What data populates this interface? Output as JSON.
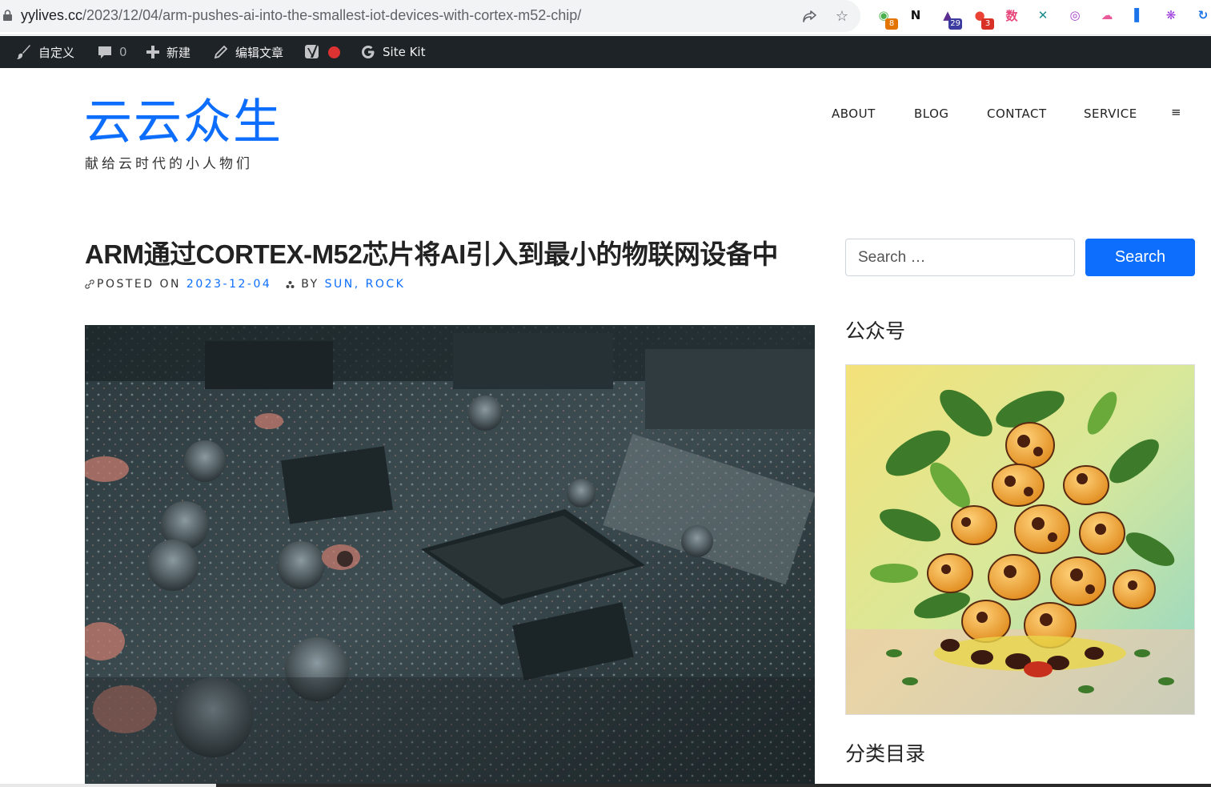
{
  "browser": {
    "url_host": "yylives.cc",
    "url_path": "/2023/12/04/arm-pushes-ai-into-the-smallest-iot-devices-with-cortex-m52-chip/",
    "extensions": [
      {
        "icon": "chrome-extension-multicolor-icon",
        "badge": "8",
        "badge_color": "#e37400"
      },
      {
        "icon": "notion-icon",
        "badge": ""
      },
      {
        "icon": "graduation-cap-icon",
        "badge": "29",
        "badge_color": "#3c3ca0"
      },
      {
        "icon": "red-extension-icon",
        "badge": "3",
        "badge_color": "#d93025"
      },
      {
        "icon": "translate-icon",
        "badge": ""
      },
      {
        "icon": "teal-extension-icon",
        "badge": ""
      },
      {
        "icon": "purple-circle-icon",
        "badge": ""
      },
      {
        "icon": "cat-icon",
        "badge": ""
      },
      {
        "icon": "blue-flag-icon",
        "badge": ""
      },
      {
        "icon": "openai-icon",
        "badge": ""
      },
      {
        "icon": "sync-icon",
        "badge": ""
      }
    ]
  },
  "admin_bar": {
    "customize": "自定义",
    "comments_count": "0",
    "new": "新建",
    "edit_post": "编辑文章",
    "site_kit": "Site Kit"
  },
  "site": {
    "title": "云云众生",
    "tagline": "献给云时代的小人物们"
  },
  "nav": {
    "items": [
      "ABOUT",
      "BLOG",
      "CONTACT",
      "SERVICE"
    ],
    "menu_icon": "≡"
  },
  "post": {
    "title": "ARM通过CORTEX-M52芯片将AI引入到最小的物联网设备中",
    "posted_on_label": "POSTED ON",
    "date": "2023-12-04",
    "by_label": "BY",
    "authors": "SUN, ROCK"
  },
  "sidebar": {
    "search_placeholder": "Search …",
    "search_button": "Search",
    "widget_wechat_title": "公众号",
    "widget_categories_title": "分类目录"
  },
  "colors": {
    "accent": "#0d6efd",
    "admin_bar": "#1d2327"
  }
}
